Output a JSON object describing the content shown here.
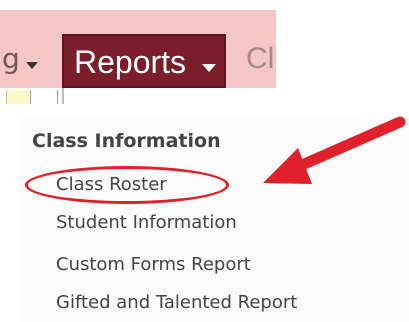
{
  "menubar": {
    "prev_label_tail": "g",
    "reports_label": "Reports",
    "next_label_fragment": "Cl"
  },
  "panel": {
    "header": "Class Information",
    "items": [
      {
        "label": "Class Roster"
      },
      {
        "label": "Student Information"
      },
      {
        "label": "Custom Forms Report"
      },
      {
        "label": "Gifted and Talented Report"
      }
    ]
  },
  "annotation": {
    "color": "#e0212b",
    "highlight_target": "Class Roster"
  },
  "colors": {
    "menubar_bg": "#f4c7c6",
    "reports_bg": "#7b1e2c",
    "panel_text": "#444444"
  }
}
